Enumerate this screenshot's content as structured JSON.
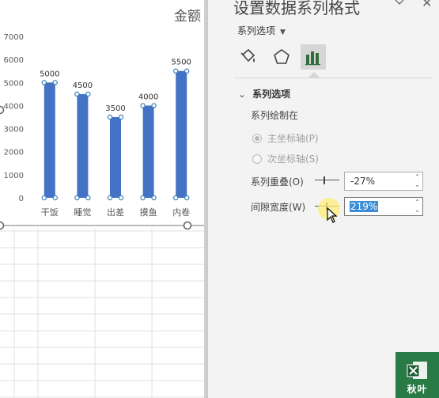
{
  "chart_data": {
    "type": "bar",
    "title": "金额",
    "categories": [
      "干饭",
      "睡觉",
      "出差",
      "摸鱼",
      "内卷"
    ],
    "values": [
      5000,
      4500,
      3500,
      4000,
      5500
    ],
    "ylim": [
      0,
      7000
    ],
    "yticks": [
      0,
      1000,
      2000,
      3000,
      4000,
      5000,
      6000,
      7000
    ],
    "grid": false,
    "bar_color": "#4472c4",
    "data_labels": true,
    "selected": true
  },
  "pane": {
    "title": "设置数据系列格式",
    "collapse_icon": "chevron-down-icon",
    "close_icon": "close-icon",
    "series_dropdown": "系列选项",
    "tabs": [
      "fill-bucket-icon",
      "pentagon-icon",
      "bar-chart-icon"
    ],
    "active_tab": "bar-chart-icon",
    "section_title": "系列选项",
    "plot_on_label": "系列绘制在",
    "primary_axis_label": "主坐标轴(P)",
    "secondary_axis_label": "次坐标轴(S)",
    "overlap_label": "系列重叠(O)",
    "overlap_value": "-27%",
    "gap_label": "间隙宽度(W)",
    "gap_value": "219%"
  },
  "watermark": {
    "text": "秋叶",
    "icon": "excel-icon",
    "color": "#2a7a46"
  }
}
